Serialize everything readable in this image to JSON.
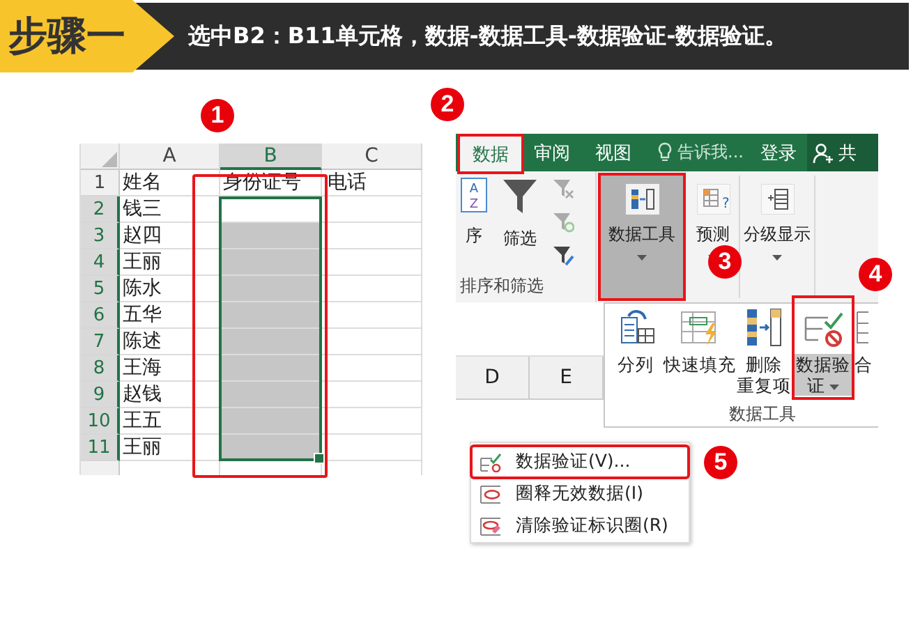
{
  "header": {
    "step": "步骤一",
    "instruction": "选中B2：B11单元格，数据-数据工具-数据验证-数据验证。"
  },
  "sheet": {
    "columns": [
      {
        "label": "A",
        "selected": false
      },
      {
        "label": "B",
        "selected": true
      },
      {
        "label": "C",
        "selected": false
      }
    ],
    "rows": [
      {
        "number": "1",
        "cells": [
          "姓名",
          "身份证号",
          "电话"
        ],
        "selected": false
      },
      {
        "number": "2",
        "cells": [
          "钱三"
        ],
        "selected": true
      },
      {
        "number": "3",
        "cells": [
          "赵四"
        ],
        "selected": true
      },
      {
        "number": "4",
        "cells": [
          "王丽"
        ],
        "selected": true
      },
      {
        "number": "5",
        "cells": [
          "陈水"
        ],
        "selected": true
      },
      {
        "number": "6",
        "cells": [
          "五华"
        ],
        "selected": true
      },
      {
        "number": "7",
        "cells": [
          "陈述"
        ],
        "selected": true
      },
      {
        "number": "8",
        "cells": [
          "王海"
        ],
        "selected": true
      },
      {
        "number": "9",
        "cells": [
          "赵钱"
        ],
        "selected": true
      },
      {
        "number": "10",
        "cells": [
          "王五"
        ],
        "selected": true
      },
      {
        "number": "11",
        "cells": [
          "王丽"
        ],
        "selected": true
      }
    ]
  },
  "ribbon": {
    "tabs": [
      {
        "label": "数据",
        "selected": true
      },
      {
        "label": "审阅",
        "selected": false
      },
      {
        "label": "视图",
        "selected": false
      }
    ],
    "sort_icon": [
      "A",
      "Z"
    ],
    "forecast_icon_mark": "?",
    "tell_me": "告诉我...",
    "login": "登录",
    "share": "共",
    "sort_label": "序",
    "filter_label": "筛选",
    "group_label": "排序和筛选",
    "buttons": [
      {
        "label": "数据工具",
        "selected": true
      },
      {
        "label": "预测",
        "selected": false
      },
      {
        "label": "分级显示",
        "selected": false
      }
    ]
  },
  "data_tools": {
    "items": [
      {
        "lines": [
          "分列"
        ],
        "selected": false
      },
      {
        "lines": [
          "快速填充"
        ],
        "selected": false
      },
      {
        "lines": [
          "删除",
          "重复项"
        ],
        "selected": false
      },
      {
        "lines": [
          "数据验",
          "证"
        ],
        "selected": true
      }
    ],
    "partial": "合",
    "group_label": "数据工具"
  },
  "columns_below": [
    "D",
    "E"
  ],
  "menu": {
    "items": [
      {
        "label": "数据验证(V)...",
        "selected": true
      },
      {
        "label": "圈释无效数据(I)",
        "selected": false
      },
      {
        "label": "清除验证标识圈(R)",
        "selected": false
      }
    ]
  },
  "badges": [
    "1",
    "2",
    "3",
    "4",
    "5"
  ]
}
